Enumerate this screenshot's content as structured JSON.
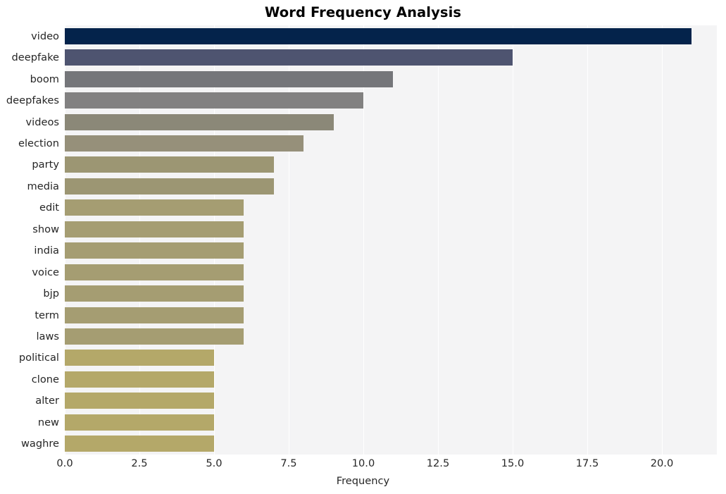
{
  "chart_data": {
    "type": "bar",
    "orientation": "horizontal",
    "title": "Word Frequency Analysis",
    "xlabel": "Frequency",
    "ylabel": "",
    "categories": [
      "video",
      "deepfake",
      "boom",
      "deepfakes",
      "videos",
      "election",
      "party",
      "media",
      "edit",
      "show",
      "india",
      "voice",
      "bjp",
      "term",
      "laws",
      "political",
      "clone",
      "alter",
      "new",
      "waghre"
    ],
    "values": [
      21,
      15,
      11,
      10,
      9,
      8,
      7,
      7,
      6,
      6,
      6,
      6,
      6,
      6,
      6,
      5,
      5,
      5,
      5,
      5
    ],
    "xlim": [
      0,
      21.84
    ],
    "xticks": [
      0.0,
      2.5,
      5.0,
      7.5,
      10.0,
      12.5,
      15.0,
      17.5,
      20.0
    ],
    "xtick_labels": [
      "0.0",
      "2.5",
      "5.0",
      "7.5",
      "10.0",
      "12.5",
      "15.0",
      "17.5",
      "20.0"
    ],
    "grid": true,
    "legend": false,
    "bar_colors": [
      "#04234b",
      "#4e5470",
      "#75767a",
      "#828181",
      "#8b8878",
      "#96907a",
      "#9c9673",
      "#9c9673",
      "#a59d72",
      "#a59d72",
      "#a59d72",
      "#a59d72",
      "#a59d72",
      "#a59d72",
      "#a59d72",
      "#b4a869",
      "#b4a869",
      "#b4a869",
      "#b4a869",
      "#b4a869"
    ],
    "plot_background": "#f4f4f5",
    "grid_color": "#ffffff",
    "figure_background": "#ffffff",
    "text_color": "#262626"
  }
}
